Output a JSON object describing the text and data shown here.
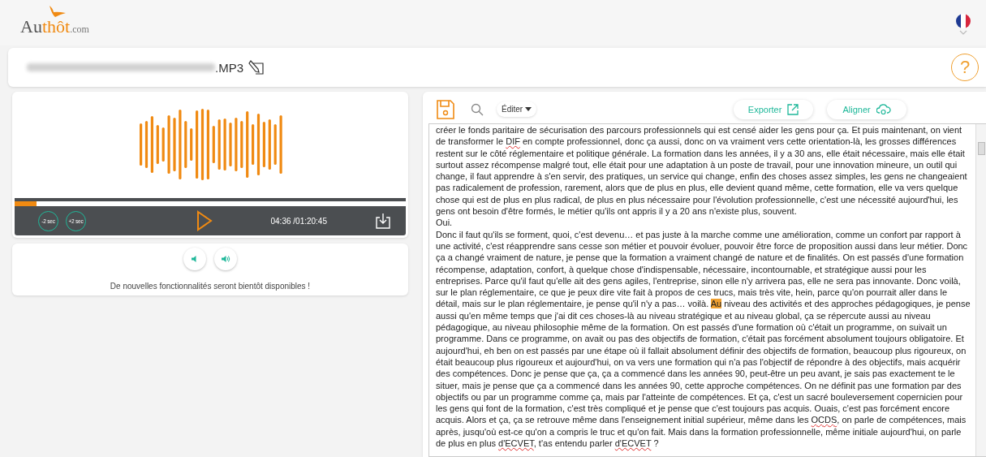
{
  "logo": {
    "dark": "Au",
    "accent": "thôt",
    "suffix": ".com"
  },
  "file": {
    "extension": ".MP3"
  },
  "help": {
    "label": "?"
  },
  "player": {
    "progress": {
      "level": 0.057
    },
    "buttons": [
      {
        "label": "-2 sec"
      },
      {
        "label": "+2 sec"
      }
    ],
    "time": "04:36 /01:20:45"
  },
  "volume": {
    "notice": "De nouvelles fonctionnalités seront bientôt disponibles !"
  },
  "toolbar": {
    "edit_menu": "Éditer",
    "export": "Exporter",
    "align": "Aligner"
  },
  "transcript": [
    {
      "segments": [
        {
          "kind": "plain",
          "text": "créer le fonds paritaire de sécurisation des parcours professionnels qui est censé aider les gens pour ça. Et puis maintenant, on vient de transformer le "
        },
        {
          "kind": "spelling",
          "text": "DIF"
        },
        {
          "kind": "plain",
          "text": " en compte professionnel, donc ça aussi, donc on va vraiment vers cette orientation-là, les grosses différences restent sur le côté réglementaire et politique générale. La formation dans les années, il y a 30 ans, elle était nécessaire, mais elle était surtout assez récompense malgré tout, elle était pour une adaptation à un poste de travail, pour une innovation mineure, un outil qui change, il faut apprendre à s'en servir, des pratiques, un service qui change, enfin des choses assez simples, les gens ne changeaient pas radicalement de profession, rarement, alors que de plus en plus, elle devient quand même, cette formation, elle va vers quelque chose qui est de plus en plus radical, de plus en plus nécessaire pour l'évolution professionnelle, c'est une nécessité aujourd'hui, les gens ont besoin d'être formés, le métier qu'ils ont appris il y a 20 ans n'existe plus, souvent."
        }
      ]
    },
    {
      "segments": [
        {
          "kind": "plain",
          "text": "Oui."
        }
      ]
    },
    {
      "segments": [
        {
          "kind": "plain",
          "text": "Donc il faut qu'ils se forment, quoi, c'est devenu… et pas juste à la marche comme une amélioration, comme un confort par rapport à une activité, c'est réapprendre sans cesse son métier et pouvoir évoluer, pouvoir être force de proposition aussi dans leur métier. Donc ça a changé vraiment de nature, je pense que la formation a vraiment changé de nature et de finalités. On est passés d'une formation récompense, adaptation, confort, à quelque chose d'indispensable, nécessaire, incontournable, et stratégique aussi pour les entreprises. Parce qu'il faut qu'elle ait des gens agiles, l'entreprise, sinon elle n'y arrivera pas, elle ne sera pas innovante. Donc voilà, sur le plan réglementaire, ce que je peux dire vite fait à propos de ces trucs, mais très vite, hein, parce qu'on pourrait aller dans le détail, mais sur le plan réglementaire, je pense qu'il n'y a pas… voilà. "
        },
        {
          "kind": "highlight",
          "text": "Au"
        },
        {
          "kind": "plain",
          "text": " niveau des activités et des approches pédagogiques, je pense aussi qu'en même temps que j'ai dit ces choses-là au niveau stratégique et au niveau global, ça se répercute aussi au niveau pédagogique, au niveau philosophie même de la formation. On est passés d'une formation où c'était un programme, on suivait un programme. Dans ce programme, on avait ou pas des objectifs de formation, c'était pas forcément absolument toujours obligatoire. Et aujourd'hui, eh ben on est passés par une étape où il fallait absolument définir des objectifs de formation, beaucoup plus rigoureux, on était beaucoup plus rigoureux et aujourd'hui, on va vers une formation qui n'a pas l'objectif de répondre à des objectifs, mais acquérir des compétences. Donc je pense que ça, ça a commencé dans les années 90, peut-être un peu avant, je sais pas exactement te le situer, mais je pense que ça a commencé dans les années 90, cette approche compétences. On ne définit pas une formation par des objectifs ou par un programme comme ça, mais par l'atteinte de compétences. Et ça, c'est un sacré bouleversement copernicien pour les gens qui font de la formation, c'est très compliqué et je pense que c'est toujours pas acquis. Ouais, c'est pas forcément encore acquis. Alors et ça, ça se retrouve même dans l'enseignement initial supérieur, même dans les "
        },
        {
          "kind": "spelling",
          "text": "OCDS"
        },
        {
          "kind": "plain",
          "text": ", on parle de compétences, mais après, jusqu'où est-ce qu'on a compris le truc et qu'on fait. Mais dans la formation professionnelle, même initiale aujourd'hui, on parle de plus en plus "
        },
        {
          "kind": "spelling",
          "text": "d'ECVET"
        },
        {
          "kind": "plain",
          "text": ", t'as entendu parler "
        },
        {
          "kind": "spelling",
          "text": "d'ECVET"
        },
        {
          "kind": "plain",
          "text": " ?"
        }
      ]
    }
  ]
}
